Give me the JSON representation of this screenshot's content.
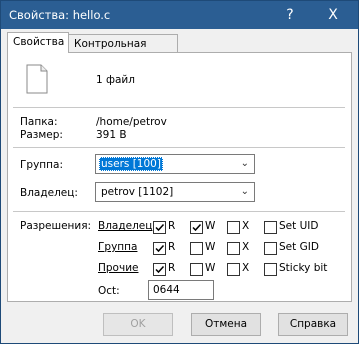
{
  "window": {
    "title": "Свойства: hello.c",
    "help_glyph": "?",
    "close_glyph": "X"
  },
  "tabs": [
    {
      "label": "Свойства",
      "active": true
    },
    {
      "label": "Контрольная сумма",
      "active": false
    }
  ],
  "summary": {
    "file_count": "1 файл"
  },
  "info": {
    "folder_label": "Папка:",
    "folder_value": "/home/petrov",
    "size_label": "Размер:",
    "size_value": "391 B"
  },
  "group": {
    "label": "Группа:",
    "value": "users [100]"
  },
  "owner": {
    "label": "Владелец:",
    "value": "petrov [1102]"
  },
  "permissions": {
    "label": "Разрешения:",
    "rows": [
      {
        "name": "Владелец",
        "r": true,
        "w": true,
        "x": false,
        "special": "Set UID",
        "special_checked": false
      },
      {
        "name": "Группа",
        "r": true,
        "w": false,
        "x": false,
        "special": "Set GID",
        "special_checked": false
      },
      {
        "name": "Прочие",
        "r": true,
        "w": false,
        "x": false,
        "special": "Sticky bit",
        "special_checked": false
      }
    ],
    "col_r": "R",
    "col_w": "W",
    "col_x": "X",
    "octal_label": "Oct:",
    "octal_value": "0644"
  },
  "buttons": {
    "ok": "OK",
    "cancel": "Отмена",
    "help": "Справка"
  },
  "colors": {
    "titlebar": "#2b5e93",
    "selection": "#0078d7"
  }
}
